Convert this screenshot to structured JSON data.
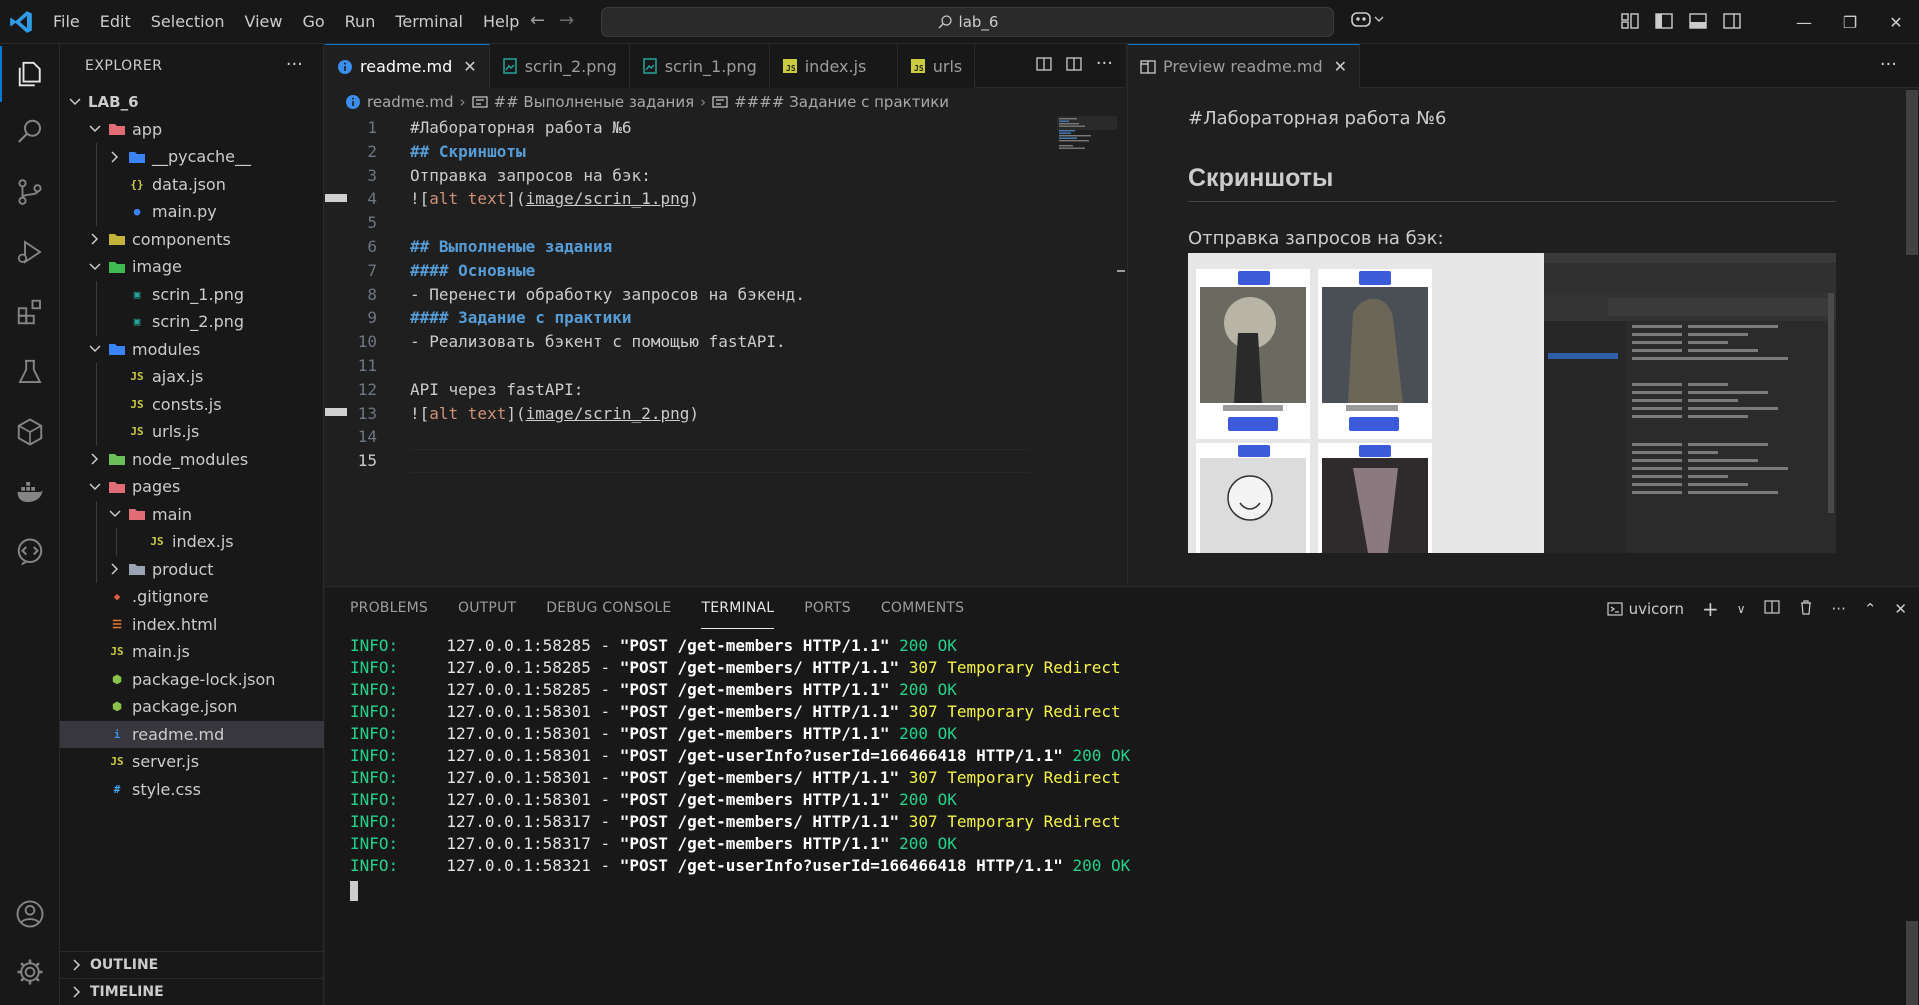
{
  "window": {
    "menu": [
      "File",
      "Edit",
      "Selection",
      "View",
      "Go",
      "Run",
      "Terminal",
      "Help"
    ],
    "search_text": "lab_6"
  },
  "sidebar": {
    "title": "EXPLORER",
    "root": "LAB_6",
    "tree": [
      {
        "label": "app",
        "depth": 1,
        "type": "folder",
        "open": true,
        "icon_color": "#e06c75"
      },
      {
        "label": "__pycache__",
        "depth": 2,
        "type": "folder",
        "open": false,
        "icon_color": "#3b82f6"
      },
      {
        "label": "data.json",
        "depth": 2,
        "type": "json"
      },
      {
        "label": "main.py",
        "depth": 2,
        "type": "python"
      },
      {
        "label": "components",
        "depth": 1,
        "type": "folder",
        "open": false,
        "icon_color": "#c4b33a"
      },
      {
        "label": "image",
        "depth": 1,
        "type": "folder",
        "open": true,
        "icon_color": "#3fb950"
      },
      {
        "label": "scrin_1.png",
        "depth": 2,
        "type": "image"
      },
      {
        "label": "scrin_2.png",
        "depth": 2,
        "type": "image"
      },
      {
        "label": "modules",
        "depth": 1,
        "type": "folder",
        "open": true,
        "icon_color": "#3b82f6"
      },
      {
        "label": "ajax.js",
        "depth": 2,
        "type": "js"
      },
      {
        "label": "consts.js",
        "depth": 2,
        "type": "js"
      },
      {
        "label": "urls.js",
        "depth": 2,
        "type": "js"
      },
      {
        "label": "node_modules",
        "depth": 1,
        "type": "folder",
        "open": false,
        "icon_color": "#6bbf59"
      },
      {
        "label": "pages",
        "depth": 1,
        "type": "folder",
        "open": true,
        "icon_color": "#e06c75"
      },
      {
        "label": "main",
        "depth": 2,
        "type": "folder",
        "open": true,
        "icon_color": "#e06c75"
      },
      {
        "label": "index.js",
        "depth": 3,
        "type": "js"
      },
      {
        "label": "product",
        "depth": 2,
        "type": "folder",
        "open": false,
        "icon_color": "#9aa4b2"
      },
      {
        "label": ".gitignore",
        "depth": 1,
        "type": "git"
      },
      {
        "label": "index.html",
        "depth": 1,
        "type": "html"
      },
      {
        "label": "main.js",
        "depth": 1,
        "type": "js"
      },
      {
        "label": "package-lock.json",
        "depth": 1,
        "type": "npm"
      },
      {
        "label": "package.json",
        "depth": 1,
        "type": "npm"
      },
      {
        "label": "readme.md",
        "depth": 1,
        "type": "info",
        "selected": true
      },
      {
        "label": "server.js",
        "depth": 1,
        "type": "js"
      },
      {
        "label": "style.css",
        "depth": 1,
        "type": "css"
      }
    ],
    "outline": "OUTLINE",
    "timeline": "TIMELINE"
  },
  "tabs": [
    {
      "label": "readme.md",
      "icon": "info-icon",
      "active": true
    },
    {
      "label": "scrin_2.png",
      "icon": "image-icon"
    },
    {
      "label": "scrin_1.png",
      "icon": "image-icon"
    },
    {
      "label": "index.js",
      "icon": "js-icon"
    },
    {
      "label": "urls",
      "icon": "js-icon"
    }
  ],
  "breadcrumb": {
    "file": "readme.md",
    "section": "## Выполненые задания",
    "subsection": "#### Задание с практики"
  },
  "code": [
    {
      "n": "1",
      "parts": [
        {
          "t": "#Лабораторная работа №6",
          "c": ""
        }
      ]
    },
    {
      "n": "2",
      "parts": [
        {
          "t": "## Скриншоты",
          "c": "h"
        }
      ]
    },
    {
      "n": "3",
      "parts": [
        {
          "t": "Отправка запросов на бэк:",
          "c": ""
        }
      ]
    },
    {
      "n": "4",
      "parts": [
        {
          "t": "![",
          "c": ""
        },
        {
          "t": "alt text",
          "c": "lk"
        },
        {
          "t": "](",
          "c": ""
        },
        {
          "t": "image/scrin_1.png",
          "c": "lku"
        },
        {
          "t": ")",
          "c": ""
        }
      ]
    },
    {
      "n": "5",
      "parts": []
    },
    {
      "n": "6",
      "parts": [
        {
          "t": "## Выполненые задания",
          "c": "h"
        }
      ]
    },
    {
      "n": "7",
      "parts": [
        {
          "t": "#### Основные",
          "c": "h"
        }
      ]
    },
    {
      "n": "8",
      "parts": [
        {
          "t": "- Перенести обработку запросов на бэкенд.",
          "c": ""
        }
      ]
    },
    {
      "n": "9",
      "parts": [
        {
          "t": "#### Задание с практики",
          "c": "h"
        }
      ]
    },
    {
      "n": "10",
      "parts": [
        {
          "t": "- Реализовать бэкент с помощью fastAPI.",
          "c": ""
        }
      ]
    },
    {
      "n": "11",
      "parts": []
    },
    {
      "n": "12",
      "parts": [
        {
          "t": "API через fastAPI:",
          "c": ""
        }
      ]
    },
    {
      "n": "13",
      "parts": [
        {
          "t": "![",
          "c": ""
        },
        {
          "t": "alt text",
          "c": "lk"
        },
        {
          "t": "](",
          "c": ""
        },
        {
          "t": "image/scrin_2.png",
          "c": "lku"
        },
        {
          "t": ")",
          "c": ""
        }
      ]
    },
    {
      "n": "14",
      "parts": []
    },
    {
      "n": "15",
      "parts": [],
      "current": true
    }
  ],
  "preview": {
    "tab_label": "Preview readme.md",
    "p1": "#Лабораторная работа №6",
    "h2": "Скриншоты",
    "p2": "Отправка запросов на бэк:"
  },
  "panel": {
    "tabs": [
      "PROBLEMS",
      "OUTPUT",
      "DEBUG CONSOLE",
      "TERMINAL",
      "PORTS",
      "COMMENTS"
    ],
    "active_tab": "TERMINAL",
    "terminal_name": "uvicorn",
    "lines": [
      {
        "prefix": "INFO:",
        "addr": "127.0.0.1:58285",
        "req": "\"POST /get-members HTTP/1.1\"",
        "status": "200 OK",
        "kind": "ok"
      },
      {
        "prefix": "INFO:",
        "addr": "127.0.0.1:58285",
        "req": "\"POST /get-members/ HTTP/1.1\"",
        "status": "307 Temporary Redirect",
        "kind": "redirect"
      },
      {
        "prefix": "INFO:",
        "addr": "127.0.0.1:58285",
        "req": "\"POST /get-members HTTP/1.1\"",
        "status": "200 OK",
        "kind": "ok"
      },
      {
        "prefix": "INFO:",
        "addr": "127.0.0.1:58301",
        "req": "\"POST /get-members/ HTTP/1.1\"",
        "status": "307 Temporary Redirect",
        "kind": "redirect"
      },
      {
        "prefix": "INFO:",
        "addr": "127.0.0.1:58301",
        "req": "\"POST /get-members HTTP/1.1\"",
        "status": "200 OK",
        "kind": "ok"
      },
      {
        "prefix": "INFO:",
        "addr": "127.0.0.1:58301",
        "req": "\"POST /get-userInfo?userId=166466418 HTTP/1.1\"",
        "status": "200 OK",
        "kind": "ok"
      },
      {
        "prefix": "INFO:",
        "addr": "127.0.0.1:58301",
        "req": "\"POST /get-members/ HTTP/1.1\"",
        "status": "307 Temporary Redirect",
        "kind": "redirect"
      },
      {
        "prefix": "INFO:",
        "addr": "127.0.0.1:58301",
        "req": "\"POST /get-members HTTP/1.1\"",
        "status": "200 OK",
        "kind": "ok"
      },
      {
        "prefix": "INFO:",
        "addr": "127.0.0.1:58317",
        "req": "\"POST /get-members/ HTTP/1.1\"",
        "status": "307 Temporary Redirect",
        "kind": "redirect"
      },
      {
        "prefix": "INFO:",
        "addr": "127.0.0.1:58317",
        "req": "\"POST /get-members HTTP/1.1\"",
        "status": "200 OK",
        "kind": "ok"
      },
      {
        "prefix": "INFO:",
        "addr": "127.0.0.1:58321",
        "req": "\"POST /get-userInfo?userId=166466418 HTTP/1.1\"",
        "status": "200 OK",
        "kind": "ok"
      }
    ]
  },
  "colors": {
    "accent": "#0078d4",
    "status_ok": "#23d18b",
    "status_redirect": "#f5f543"
  }
}
